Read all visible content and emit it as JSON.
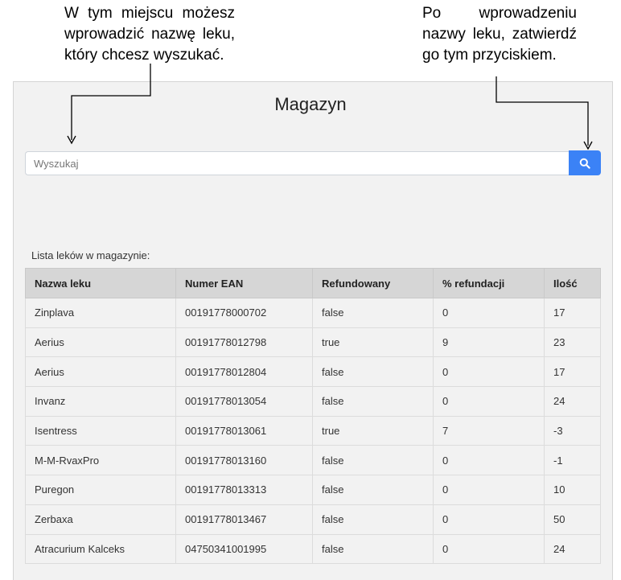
{
  "annotations": {
    "left": "W tym miejscu możesz wprowadzić nazwę leku, który chcesz wyszukać.",
    "right": "Po wprowadzeniu nazwy leku, zatwierdź go tym przyciskiem."
  },
  "page_title": "Magazyn",
  "search": {
    "placeholder": "Wyszukaj",
    "value": "",
    "button_icon": "search-icon",
    "button_color": "#3b82f6"
  },
  "list_caption": "Lista leków w magazynie:",
  "table": {
    "headers": [
      "Nazwa leku",
      "Numer EAN",
      "Refundowany",
      "% refundacji",
      "Ilość"
    ],
    "rows": [
      [
        "Zinplava",
        "00191778000702",
        "false",
        "0",
        "17"
      ],
      [
        "Aerius",
        "00191778012798",
        "true",
        "9",
        "23"
      ],
      [
        "Aerius",
        "00191778012804",
        "false",
        "0",
        "17"
      ],
      [
        "Invanz",
        "00191778013054",
        "false",
        "0",
        "24"
      ],
      [
        "Isentress",
        "00191778013061",
        "true",
        "7",
        "-3"
      ],
      [
        "M-M-RvaxPro",
        "00191778013160",
        "false",
        "0",
        "-1"
      ],
      [
        "Puregon",
        "00191778013313",
        "false",
        "0",
        "10"
      ],
      [
        "Zerbaxa",
        "00191778013467",
        "false",
        "0",
        "50"
      ],
      [
        "Atracurium Kalceks",
        "04750341001995",
        "false",
        "0",
        "24"
      ]
    ]
  }
}
